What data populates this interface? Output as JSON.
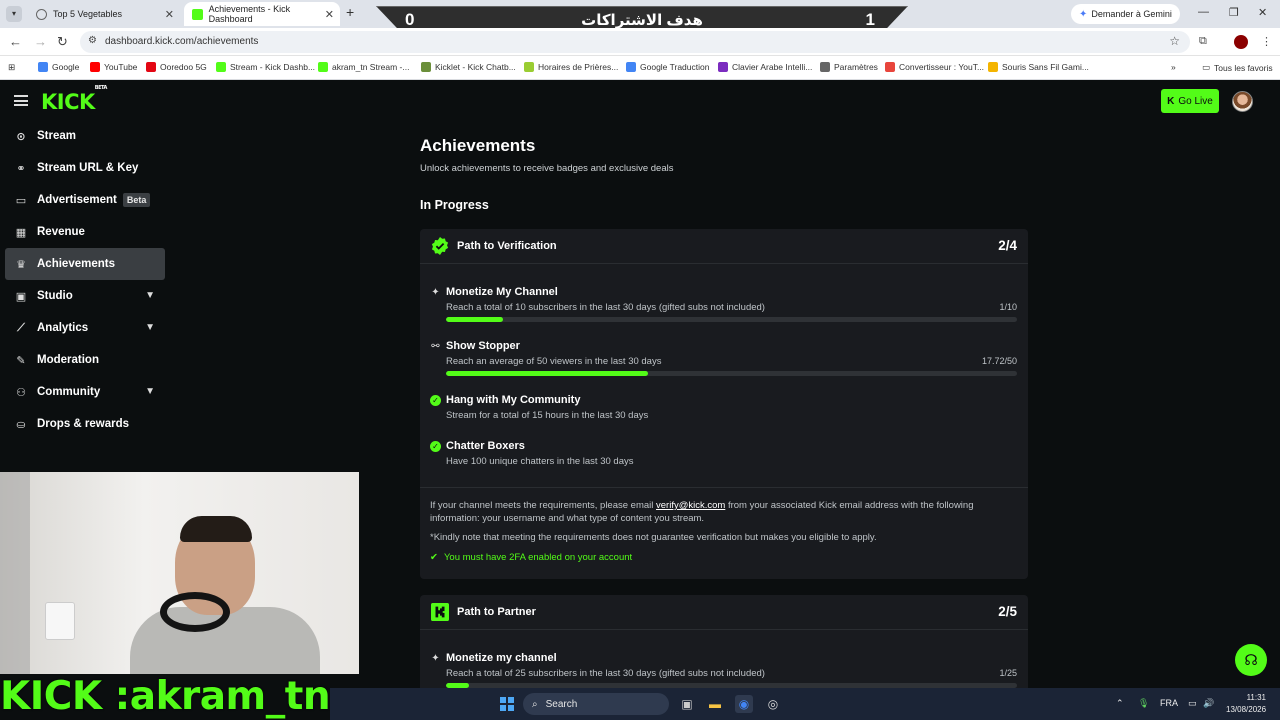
{
  "browser": {
    "tabs": [
      {
        "title": "Top 5 Vegetables",
        "active": false
      },
      {
        "title": "Achievements - Kick Dashboard",
        "active": true
      }
    ],
    "gemini_label": "Demander à Gemini",
    "url": "dashboard.kick.com/achievements",
    "bookmarks": [
      {
        "label": "Google",
        "color": "#4285f4"
      },
      {
        "label": "YouTube",
        "color": "#ff0000"
      },
      {
        "label": "Ooredoo 5G",
        "color": "#e30613"
      },
      {
        "label": "Stream - Kick Dashb...",
        "color": "#53fc18"
      },
      {
        "label": "akram_tn Stream -...",
        "color": "#53fc18"
      },
      {
        "label": "Kicklet - Kick Chatb...",
        "color": "#6b8f3a"
      },
      {
        "label": "Horaires de Prières...",
        "color": "#9acd32"
      },
      {
        "label": "Google Traduction",
        "color": "#4285f4"
      },
      {
        "label": "Clavier Arabe Intelli...",
        "color": "#7b2cbf"
      },
      {
        "label": "Paramètres",
        "color": "#666666"
      },
      {
        "label": "Convertisseur : YouT...",
        "color": "#e8453c"
      },
      {
        "label": "Souris Sans Fil Gami...",
        "color": "#f4b400"
      }
    ],
    "all_bookmarks": "Tous les favoris"
  },
  "overlay_banner": {
    "left_value": "0",
    "title": "هدف الاشتراكات",
    "right_value": "1"
  },
  "header": {
    "logo": "KICK",
    "logo_tag": "BETA",
    "go_live": "Go Live"
  },
  "sidebar": {
    "items": [
      {
        "label": "Stream",
        "icon": "broadcast-icon",
        "glyph": "⊙"
      },
      {
        "label": "Stream URL & Key",
        "icon": "link-icon",
        "glyph": "⚭"
      },
      {
        "label": "Advertisement",
        "icon": "window-icon",
        "glyph": "▭",
        "badge": "Beta"
      },
      {
        "label": "Revenue",
        "icon": "chart-icon",
        "glyph": "▦"
      },
      {
        "label": "Achievements",
        "icon": "trophy-icon",
        "glyph": "♛",
        "active": true
      },
      {
        "label": "Studio",
        "icon": "grid-icon",
        "glyph": "▣",
        "expandable": true
      },
      {
        "label": "Analytics",
        "icon": "analytics-icon",
        "glyph": "⟋",
        "expandable": true
      },
      {
        "label": "Moderation",
        "icon": "wrench-icon",
        "glyph": "✎"
      },
      {
        "label": "Community",
        "icon": "users-icon",
        "glyph": "⚇",
        "expandable": true
      },
      {
        "label": "Drops & rewards",
        "icon": "gift-icon",
        "glyph": "⛀"
      }
    ]
  },
  "main": {
    "title": "Achievements",
    "subtitle": "Unlock achievements to receive badges and exclusive deals",
    "section": "In Progress",
    "verification": {
      "title": "Path to Verification",
      "count": "2/4",
      "tasks": [
        {
          "title": "Monetize My Channel",
          "desc": "Reach a total of 10 subscribers in the last 30 days (gifted subs not included)",
          "progress": "1/10",
          "ratio": 0.1,
          "state": "progress",
          "icon": "sparkle-icon",
          "glyph": "✦"
        },
        {
          "title": "Show Stopper",
          "desc": "Reach an average of 50 viewers in the last 30 days",
          "progress": "17.72/50",
          "ratio": 0.3544,
          "state": "progress",
          "icon": "viewers-icon",
          "glyph": "⚯"
        },
        {
          "title": "Hang with My Community",
          "desc": "Stream for a total of 15 hours in the last 30 days",
          "state": "done",
          "icon": "check-circle-icon",
          "glyph": "✓"
        },
        {
          "title": "Chatter Boxers",
          "desc": "Have 100 unique chatters in the last 30 days",
          "state": "done",
          "icon": "check-circle-icon",
          "glyph": "✓"
        }
      ],
      "note_before": "If your channel meets the requirements, please email ",
      "email": "verify@kick.com",
      "note_after": " from your associated Kick email address with the following information: your username and what type of content you stream.",
      "disclaimer": "*Kindly note that meeting the requirements does not guarantee verification but makes you eligible to apply.",
      "twofa": "You must have 2FA enabled on your account"
    },
    "partner": {
      "title": "Path to Partner",
      "count": "2/5",
      "tasks": [
        {
          "title": "Monetize my channel",
          "desc": "Reach a total of 25 subscribers in the last 30 days (gifted subs not included)",
          "progress": "1/25",
          "ratio": 0.04,
          "state": "progress",
          "icon": "sparkle-icon",
          "glyph": "✦"
        }
      ]
    }
  },
  "streamer_overlay": "KICK :akram_tn",
  "taskbar": {
    "search": "Search",
    "lang": "FRA",
    "time": "11:31",
    "date": "13/08/2026"
  },
  "colors": {
    "kick_green": "#53fc18",
    "background": "#0b0e0f",
    "card": "#191b1f"
  }
}
